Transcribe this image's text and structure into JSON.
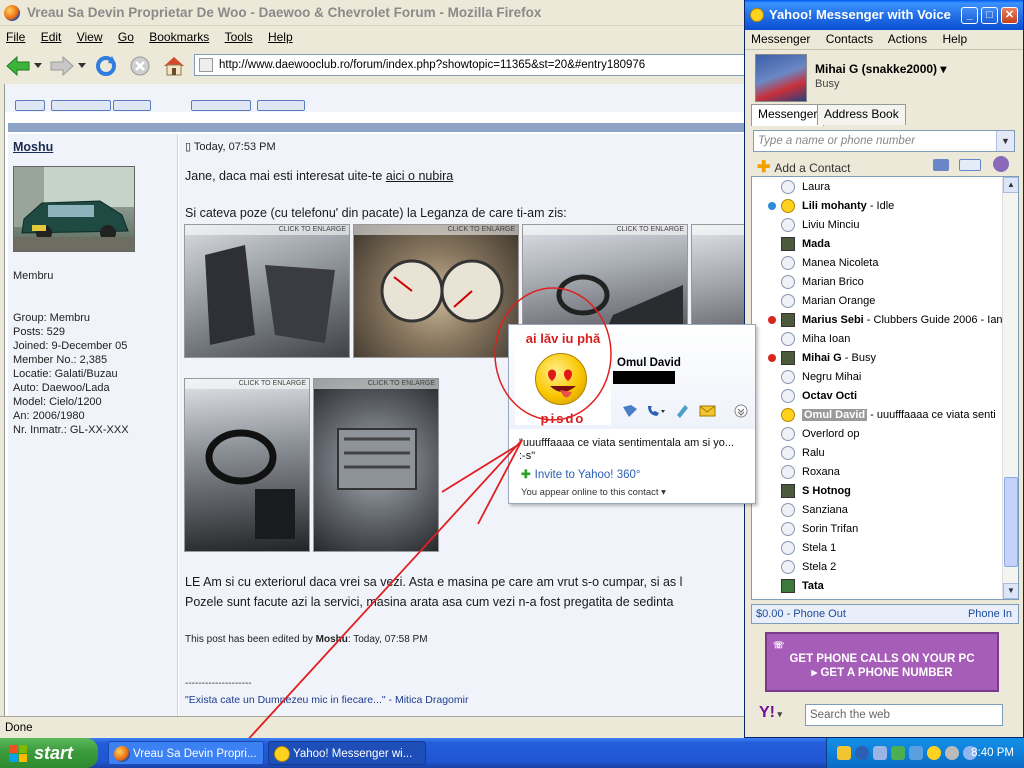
{
  "firefox": {
    "title": "Vreau Sa Devin Proprietar De Woo - Daewoo & Chevrolet Forum - Mozilla Firefox",
    "menu": [
      "File",
      "Edit",
      "View",
      "Go",
      "Bookmarks",
      "Tools",
      "Help"
    ],
    "url": "http://www.daewooclub.ro/forum/index.php?showtopic=11365&st=20&#entry180976",
    "status": "Done"
  },
  "post": {
    "author": "Moshu",
    "rank": "Membru",
    "info": [
      "Group: Membru",
      "Posts: 529",
      "Joined: 9-December 05",
      "Member No.: 2,385",
      "Locatie: Galati/Buzau",
      "Auto: Daewoo/Lada",
      "Model: Cielo/1200",
      "An: 2006/1980",
      "Nr. Inmatr.: GL-XX-XXX"
    ],
    "date": "Today, 07:53 PM",
    "line1_pre": "Jane, daca mai esti interesat uite-te ",
    "line1_link": "aici o nubira",
    "line2": "Si cateva poze (cu telefonu' din pacate) la Leganza de care ti-am zis:",
    "enlarge": "CLICK TO ENLARGE",
    "line3": "LE Am si cu exteriorul daca vrei sa vezi. Asta e masina pe care am vrut s-o cumpar, si as l",
    "line4": "Pozele sunt facute azi la servici, masina arata asa cum vezi n-a fost pregatita de sedinta",
    "edited_pre": "This post has been edited by ",
    "edited_author": "Moshu",
    "edited_post": ": Today, 07:58 PM",
    "dashes": "--------------------",
    "signature": "\"Exista cate un Dumnezeu mic in fiecare...\" - Mitica Dragomir"
  },
  "messenger": {
    "title": "Yahoo! Messenger with Voice",
    "menu": [
      "Messenger",
      "Contacts",
      "Actions",
      "Help"
    ],
    "user": "Mihai G (snakke2000)",
    "status": "Busy",
    "tabs": [
      "Messenger",
      "Address Book"
    ],
    "search_placeholder": "Type a name or phone number",
    "add_contact": "Add a Contact",
    "contacts": [
      {
        "name": "Laura",
        "extra": ""
      },
      {
        "name": "Lili mohanty",
        "extra": " - Idle",
        "bold": true
      },
      {
        "name": "Liviu Minciu",
        "extra": ""
      },
      {
        "name": "Mada",
        "extra": "",
        "bold": true
      },
      {
        "name": "Manea Nicoleta",
        "extra": ""
      },
      {
        "name": "Marian Brico",
        "extra": ""
      },
      {
        "name": "Marian Orange",
        "extra": ""
      },
      {
        "name": "Marius Sebi",
        "extra": " - Clubbers Guide 2006 - Ian",
        "bold": true
      },
      {
        "name": "Miha Ioan",
        "extra": ""
      },
      {
        "name": "Mihai G",
        "extra": " - Busy",
        "bold": true
      },
      {
        "name": "Negru Mihai",
        "extra": ""
      },
      {
        "name": "Octav Octi",
        "extra": "",
        "bold": true
      },
      {
        "name": "Omul David",
        "extra": " - uuufffaaaa ce viata senti",
        "bold": true
      },
      {
        "name": "Overlord op",
        "extra": ""
      },
      {
        "name": "Ralu",
        "extra": ""
      },
      {
        "name": "Roxana",
        "extra": ""
      },
      {
        "name": "S Hotnog",
        "extra": "",
        "bold": true
      },
      {
        "name": "Sanziana",
        "extra": ""
      },
      {
        "name": "Sorin Trifan",
        "extra": ""
      },
      {
        "name": "Stela 1",
        "extra": ""
      },
      {
        "name": "Stela 2",
        "extra": ""
      },
      {
        "name": "Tata",
        "extra": "",
        "bold": true
      }
    ],
    "phone_out": "$0.00 - Phone Out",
    "phone_in": "Phone In",
    "ad_line1": "GET PHONE CALLS ON YOUR PC",
    "ad_line2": "▸ GET A PHONE NUMBER",
    "web_search_placeholder": "Search the web",
    "logo": "Y!"
  },
  "popup": {
    "avatar_top": "ai lăv iu phă",
    "avatar_bottom": "pisdo",
    "name": "Omul David",
    "status_line1": "\"uuufffaaaa ce viata sentimentala am si yo...",
    "status_line2": ":-s\"",
    "invite": "Invite to Yahoo! 360°",
    "appear": "You appear online to this contact"
  },
  "taskbar": {
    "start": "start",
    "items": [
      "Vreau Sa Devin Propri...",
      "Yahoo! Messenger wi..."
    ],
    "clock": "8:40 PM"
  },
  "colors": {
    "annotation": "#e02020",
    "xp_blue": "#245edb",
    "yahoo_purple": "#720e9e"
  }
}
